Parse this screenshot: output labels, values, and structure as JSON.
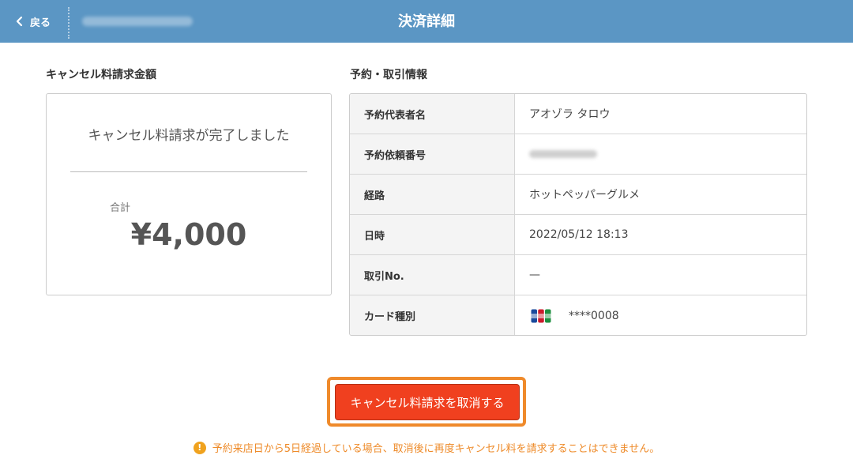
{
  "header": {
    "back_label": "戻る",
    "title": "決済詳細",
    "background_color": "#5b96c4"
  },
  "cancel_section": {
    "title": "キャンセル料請求金額",
    "message": "キャンセル料請求が完了しました",
    "total_label": "合計",
    "total_amount": "¥4,000"
  },
  "info_section": {
    "title": "予約・取引情報",
    "rows": [
      {
        "label": "予約代表者名",
        "value": "アオゾラ タロウ"
      },
      {
        "label": "予約依頼番号",
        "value": ""
      },
      {
        "label": "経路",
        "value": "ホットペッパーグルメ"
      },
      {
        "label": "日時",
        "value": "2022/05/12 18:13"
      },
      {
        "label": "取引No.",
        "value": "—"
      },
      {
        "label": "カード種別",
        "value": "****0008",
        "card_brand_icon": "jcb-card-icon"
      }
    ]
  },
  "action": {
    "button_label": "キャンセル料請求を取消する",
    "button_color": "#f0401f",
    "highlight_color": "#ef8a2b"
  },
  "notice": {
    "icon": "!",
    "text": "予約来店日から5日経過している場合、取消後に再度キャンセル料を請求することはできません。",
    "color": "#ee8b2a"
  }
}
